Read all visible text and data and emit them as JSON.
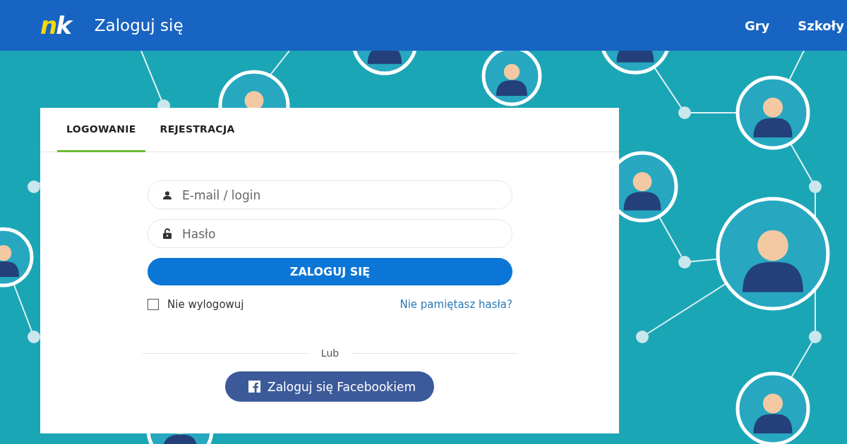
{
  "header": {
    "logo": [
      {
        "text": "n",
        "color": "#f5d90a"
      },
      {
        "text": "k",
        "color": "#ffffff"
      }
    ],
    "title": "Zaloguj się",
    "nav": [
      "Gry",
      "Szkoły"
    ]
  },
  "tabs": [
    {
      "label": "LOGOWANIE",
      "selected": true
    },
    {
      "label": "REJESTRACJA",
      "selected": false
    }
  ],
  "fields": [
    {
      "kind": "user",
      "placeholder": "E-mail / login"
    },
    {
      "kind": "lock",
      "placeholder": "Hasło"
    }
  ],
  "submit": "ZALOGUJ SIĘ",
  "remember": {
    "label": "Nie wylogowuj",
    "checked": false
  },
  "forgot": "Nie pamiętasz hasła?",
  "divider": "Lub",
  "facebook": "Zaloguj się Facebookiem"
}
